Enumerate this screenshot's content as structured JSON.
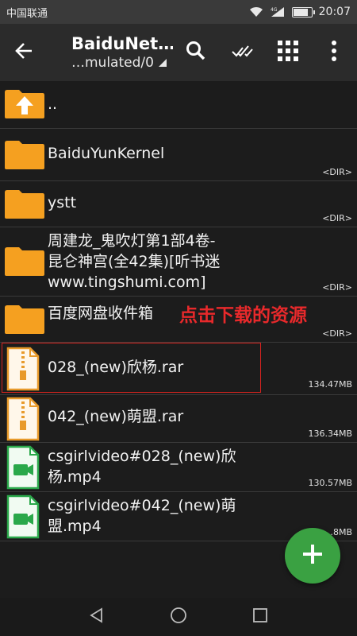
{
  "status_bar": {
    "carrier": "中国联通",
    "network": "4G",
    "battery_level": 0.85,
    "time": "20:07"
  },
  "toolbar": {
    "back_icon": "arrow-left-icon",
    "title": "BaiduNet…",
    "subtitle": "…mulated/0",
    "actions": [
      "search-icon",
      "multi-select-icon",
      "grid-view-icon",
      "more-vert-icon"
    ]
  },
  "files": [
    {
      "name": "..",
      "type": "parent",
      "meta": ""
    },
    {
      "name": "BaiduYunKernel",
      "type": "folder",
      "meta": "<DIR>"
    },
    {
      "name": "ystt",
      "type": "folder",
      "meta": "<DIR>"
    },
    {
      "name": "周建龙_鬼吹灯第1部4卷-昆仑神宫(全42集)[听书迷www.tingshumi.com]",
      "name_lines": [
        "周建龙_鬼吹灯第1部4卷-",
        "昆仑神宫(全42集)[听书迷",
        "www.tingshumi.com]"
      ],
      "type": "folder",
      "meta": "<DIR>"
    },
    {
      "name": "百度网盘收件箱",
      "type": "folder",
      "meta": "<DIR>",
      "annotation": "点击下载的资源"
    },
    {
      "name": "028_(new)欣杨.rar",
      "type": "archive",
      "meta": "134.47MB",
      "highlighted": true
    },
    {
      "name": "042_(new)萌盟.rar",
      "type": "archive",
      "meta": "136.34MB"
    },
    {
      "name": "csgirlvideo#028_(new)欣杨.mp4",
      "name_lines": [
        "csgirlvideo#028_(new)欣",
        "杨.mp4"
      ],
      "type": "video",
      "meta": "130.57MB"
    },
    {
      "name": "csgirlvideo#042_(new)萌盟.mp4",
      "name_lines": [
        "csgirlvideo#042_(new)萌",
        "盟.mp4"
      ],
      "type": "video",
      "meta": "…8MB"
    }
  ],
  "fab": {
    "icon": "plus-icon"
  },
  "nav_bar": {
    "buttons": [
      "back-triangle-icon",
      "home-circle-icon",
      "recents-square-icon"
    ]
  },
  "colors": {
    "folder": "#f5a020",
    "accent_fab": "#3aa142",
    "annotation": "#e8292b",
    "video_icon": "#2aa84a"
  }
}
